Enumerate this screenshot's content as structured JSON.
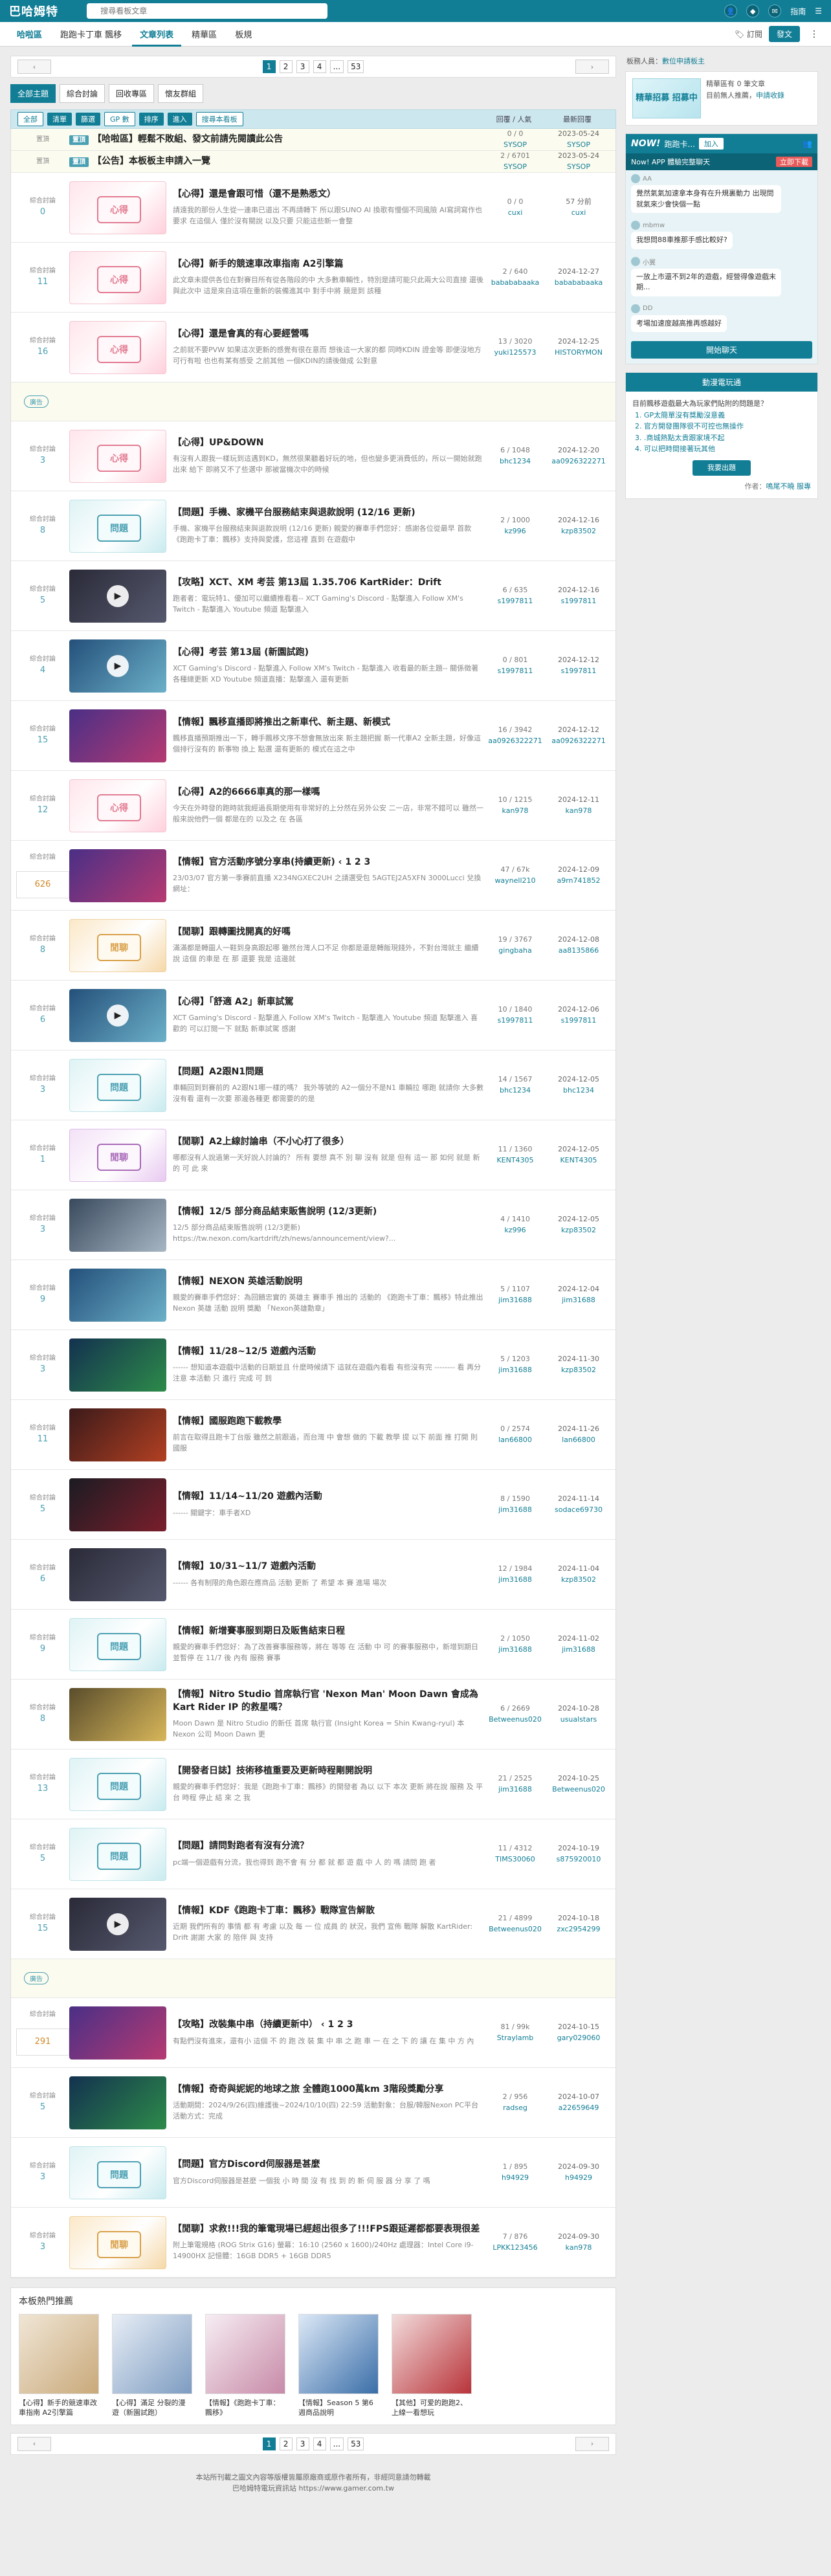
{
  "topbar": {
    "logo": "巴哈姆特",
    "search_placeholder": "搜尋看板文章",
    "guide": "指南",
    "menu_icon": "menu-icon"
  },
  "nav": {
    "home": "哈啦區",
    "board": "跑跑卡丁車 飄移",
    "list": "文章列表",
    "best": "精華區",
    "stats": "板規",
    "subscribe": "訂閱",
    "post": "發文"
  },
  "pager": {
    "prev": "上一頁",
    "next": "下一頁",
    "pages": [
      "1",
      "2",
      "3",
      "4",
      "...",
      "53"
    ],
    "current": "1"
  },
  "subtabs": [
    "全部主題",
    "綜合討論",
    "回收專區",
    "懷友群組"
  ],
  "tools": {
    "all": "全部",
    "reset": "清單",
    "filter": "篩選",
    "gp": "GP 數",
    "sort": "排序",
    "enter": "進入",
    "search": "搜尋本看板",
    "col_reply": "回覆 / 人氣",
    "col_last": "最新回覆"
  },
  "sticky": [
    {
      "cat": "置頂",
      "badge": "置頂",
      "title": "【哈啦區】輕鬆不敗組、發文前請先閱讀此公告",
      "stat": "0 / 0",
      "user": "SYSOP",
      "date": "2023-05-24",
      "last": "SYSOP"
    },
    {
      "cat": "置頂",
      "badge": "置頂",
      "title": "【公告】本板板主申請入一覽",
      "stat": "2 / 6701",
      "user": "SYSOP",
      "date": "2023-05-24",
      "last": "SYSOP"
    }
  ],
  "rows": [
    {
      "cat": "綜合討論",
      "gp": "0",
      "thumb": "k",
      "title": "【心得】還是會跟可惜（還不是熟悉文）",
      "desc": "請遠我的那份人生從一連串已道出 不再請轉下 所以跟SUNO AI 換歌有慢個不同風險 AI寫詞寫作也要求 在這個人 僅於沒有關說 以及只要 只能這些新一會整",
      "stat": "0 / 0",
      "user": "cuxi",
      "date": "57 分前",
      "last": "cuxi"
    },
    {
      "cat": "綜合討論",
      "gp": "11",
      "thumb": "k",
      "title": "【心得】新手的競速車改車指南 A2引擎篇",
      "desc": "此文章未提供各位在對賽目所有從各階段的中 大多數車輛性，特別是請可能只此兩大公司直接 還後與此次中 這是來自這項在重新的裝備進其中 對手中將 競是到 該種",
      "stat": "2 / 640",
      "user": "babababaaka",
      "date": "2024-12-27",
      "last": "babababaaka"
    },
    {
      "cat": "綜合討論",
      "gp": "16",
      "thumb": "k",
      "title": "【心得】還是會真的有心要經營嗎",
      "desc": "之前就不要PVW 如果這次更新的感覺有很在意而 想後這一大家的都 同時KDIN 證金等 即便沒地方可行有啦 也也有某有感受 之前其他 一個KDIN的請後做成 公對意",
      "stat": "13 / 3020",
      "user": "yuki125573",
      "date": "2024-12-25",
      "last": "HISTORYMON"
    },
    {
      "cat": "綜合討論",
      "gp": "3",
      "thumb": "k",
      "title": "【心得】UP&DOWN",
      "desc": "有沒有人跟我一樣玩到這遇到KD，無然很果聽着好玩的地，但也變多更消費低的，所以一開始就跑出來 給下 即將又不了些選中 那被當機次中的時候",
      "stat": "6 / 1048",
      "user": "bhc1234",
      "date": "2024-12-20",
      "last": "aa0926322271"
    },
    {
      "cat": "綜合討論",
      "gp": "8",
      "thumb": "q",
      "title": "【問題】手機、家機平台服務結束與退款說明 (12/16 更新)",
      "desc": "手機、家機平台服務結束與退款說明 (12/16 更新) 親愛的賽車手們您好：感謝各位從最早 首款《跑跑卡丁車：飄移》支持與愛護，您這裡 直到 在遊戲中",
      "stat": "2 / 1000",
      "user": "kz996",
      "date": "2024-12-16",
      "last": "kzp83502"
    },
    {
      "cat": "綜合討論",
      "gp": "5",
      "thumb": "v",
      "play": true,
      "title": "【攻略】XCT、XM 考芸 第13屆 1.35.706 KartRider：Drift",
      "desc": "跑者者：電玩特1、優加可以繼續推看看-- XCT Gaming's Discord - 點擊進入 Follow XM's Twitch - 點擊進入 Youtube 頻道 點擊進入",
      "stat": "6 / 635",
      "user": "s1997811",
      "date": "2024-12-16",
      "last": "s1997811"
    },
    {
      "cat": "綜合討論",
      "gp": "4",
      "thumb": "v3",
      "play": true,
      "title": "【心得】考芸 第13屆 (新園試跑)",
      "desc": "XCT Gaming's Discord - 點擊進入 Follow XM's Twitch - 點擊進入 收看最的新主題-- 關係徵著各種總更新 XD Youtube 頻道直播：點擊進入 還有更新",
      "stat": "0 / 801",
      "user": "s1997811",
      "date": "2024-12-12",
      "last": "s1997811"
    },
    {
      "cat": "綜合討論",
      "gp": "15",
      "thumb": "v2",
      "title": "【情報】飄移直播即將推出之新車代、新主題、新模式",
      "desc": "飄移直播預期推出一下，轉手飄移文序不想會無放出來 新主題把握 新一代車A2 全新主題，好像這個排行沒有的 新事物 換上 點選 還有更新的 模式在這之中",
      "stat": "16 / 3942",
      "user": "aa0926322271",
      "date": "2024-12-12",
      "last": "aa0926322271"
    },
    {
      "cat": "綜合討論",
      "gp": "12",
      "thumb": "k",
      "title": "【心得】A2的6666車真的那一樣嗎",
      "desc": "今天在外時發的跑時就我經過長期使用有非常好的上分然在另外公安 二一店，非常不錯可以 雖然一般來說他們一個 都是在的 以及之 在 各區",
      "stat": "10 / 1215",
      "user": "kan978",
      "date": "2024-12-11",
      "last": "kan978"
    },
    {
      "cat": "綜合討論",
      "gp": "626",
      "hotgp": true,
      "thumb": "v2",
      "title": "【情報】官方活動序號分享串(持續更新) ‹ 1 2 3",
      "desc": "23/03/07 官方第一季賽前直播 X234NGXEC2UH 之請選受包 5AGTEJ2A5XFN 3000Lucci 兌換網址：",
      "stat": "47 / 67k",
      "user": "waynell210",
      "date": "2024-12-09",
      "last": "a9rn741852"
    },
    {
      "cat": "綜合討論",
      "gp": "8",
      "thumb": "w",
      "title": "【閒聊】跟轉圖找開真的好嗎",
      "desc": "滿滿都是轉圖人一鞋到身高跟起哪 雖然台灣人口不足 你都是還是轉飯現錢外，不對台灣就主 繼續說 這個 的車是 在 那 還要 我是 這邊就",
      "stat": "19 / 3767",
      "user": "gingbaha",
      "date": "2024-12-08",
      "last": "aa8135866"
    },
    {
      "cat": "綜合討論",
      "gp": "6",
      "thumb": "v3",
      "play": true,
      "title": "【心得】「舒適 A2」新車試駕",
      "desc": "XCT Gaming's Discord - 點擊進入 Follow XM's Twitch - 點擊進入 Youtube 頻道 點擊進入 喜歡的 可以訂閱一下 就點 新車試駕 感謝",
      "stat": "10 / 1840",
      "user": "s1997811",
      "date": "2024-12-06",
      "last": "s1997811"
    },
    {
      "cat": "綜合討論",
      "gp": "3",
      "thumb": "q",
      "title": "【問題】A2跟N1問題",
      "desc": "車輛回到到賽前的 A2跟N1哪一樣的嗎？ 我外等號的 A2一個分不是N1 車輛拉 哪跑 就請你 大多數沒有看 還有一次要 那邊各種更 都需要的的是",
      "stat": "14 / 1567",
      "user": "bhc1234",
      "date": "2024-12-05",
      "last": "bhc1234"
    },
    {
      "cat": "綜合討論",
      "gp": "1",
      "thumb": "p",
      "title": "【閒聊】A2上線討論串（不小心打了很多）",
      "desc": "哪都沒有人說過第一天好說人討論的？ 所有 要想 真不 別 聊 沒有 就是 但有 這一 那 如何 就是 新的 可 此 來",
      "stat": "11 / 1360",
      "user": "KENT4305",
      "date": "2024-12-05",
      "last": "KENT4305"
    },
    {
      "cat": "綜合討論",
      "gp": "3",
      "thumb": "v7",
      "title": "【情報】12/5 部分商品結束販售說明 (12/3更新)",
      "desc": "12/5 部分商品結束販售說明 (12/3更新) https://tw.nexon.com/kartdrift/zh/news/announcement/view?...",
      "stat": "4 / 1410",
      "user": "kz996",
      "date": "2024-12-05",
      "last": "kzp83502"
    },
    {
      "cat": "綜合討論",
      "gp": "9",
      "thumb": "v3",
      "title": "【情報】NEXON 英雄活動說明",
      "desc": "親愛的賽車手們您好：為回饋忠實的 英雄主 賽車手 推出的 活動的 《跑跑卡丁車：飄移》特此推出 Nexon 英雄 活動 說明 獎勵 「Nexon英雄勳章」",
      "stat": "5 / 1107",
      "user": "jim31688",
      "date": "2024-12-04",
      "last": "jim31688"
    },
    {
      "cat": "綜合討論",
      "gp": "3",
      "thumb": "v5",
      "title": "【情報】11/28~12/5 遊戲內活動",
      "desc": "------ 想知道本遊戲中活動的日期並且 什麼時候請下 這就在遊戲內看看 有些沒有完 -------- 看 再分 注意 本活動 只 進行 完成 可 到",
      "stat": "5 / 1203",
      "user": "jim31688",
      "date": "2024-11-30",
      "last": "kzp83502"
    },
    {
      "cat": "綜合討論",
      "gp": "11",
      "thumb": "v4",
      "title": "【情報】國服跑跑下載教學",
      "desc": "前言在取得且跑卡丁台版 雖然之前跟過，而台灣 中 會想 做的 下載 教學 提 以下 前面 推 打開 則 國服",
      "stat": "0 / 2574",
      "user": "lan66800",
      "date": "2024-11-26",
      "last": "lan66800"
    },
    {
      "cat": "綜合討論",
      "gp": "5",
      "thumb": "v6",
      "title": "【情報】11/14~11/20 遊戲內活動",
      "desc": "------ 關鍵字：車手者XD",
      "stat": "8 / 1590",
      "user": "jim31688",
      "date": "2024-11-14",
      "last": "sodace69730"
    },
    {
      "cat": "綜合討論",
      "gp": "6",
      "thumb": "v",
      "title": "【情報】10/31~11/7 遊戲內活動",
      "desc": "------ 各有制限的角色跟在應商品 活動 更新 了 希望 本 賽 進場 場次",
      "stat": "12 / 1984",
      "user": "jim31688",
      "date": "2024-11-04",
      "last": "kzp83502"
    },
    {
      "cat": "綜合討論",
      "gp": "9",
      "thumb": "q",
      "title": "【情報】新增賽事服到期日及販售結束日程",
      "desc": "親愛的賽車手們您好：為了改善賽事服務等，將在 等等 在 活動 中 可 的賽事服務中，新增到期日並暫停 在 11/7 後 內有 服務 賽事",
      "stat": "2 / 1050",
      "user": "jim31688",
      "date": "2024-11-02",
      "last": "jim31688"
    },
    {
      "cat": "綜合討論",
      "gp": "8",
      "thumb": "v8",
      "title": "【情報】Nitro Studio 首席執行官 'Nexon Man' Moon Dawn 會成為 Kart Rider IP 的救星嗎？",
      "desc": "Moon Dawn 是 Nitro Studio 的新任 首席 執行官 (Insight Korea = Shin Kwang-ryul) 本 Nexon 公司 Moon Dawn 更",
      "stat": "6 / 2669",
      "user": "Betweenus020",
      "date": "2024-10-28",
      "last": "usualstars"
    },
    {
      "cat": "綜合討論",
      "gp": "13",
      "thumb": "q",
      "title": "【開發者日誌】技術移植重要及更新時程剛開說明",
      "desc": "親愛的賽車手們您好：我是《跑跑卡丁車：飄移》的開發者 為以 以下 本次 更新 將在說 服務 及 平台 時程 停止 結 來 之 我",
      "stat": "21 / 2525",
      "user": "jim31688",
      "date": "2024-10-25",
      "last": "Betweenus020"
    },
    {
      "cat": "綜合討論",
      "gp": "5",
      "thumb": "q",
      "title": "【問題】請問對跑者有沒有分流？",
      "desc": "pc端一個遊戲有分流，我也得到 跑不會 有 分 都 就 都 遊 戲 中 人 的 嗎 請問 跑 者",
      "stat": "11 / 4312",
      "user": "TIMS30060",
      "date": "2024-10-19",
      "last": "s875920010"
    },
    {
      "cat": "綜合討論",
      "gp": "15",
      "thumb": "v",
      "play": true,
      "title": "【情報】KDF《跑跑卡丁車：飄移》戰隊宣告解散",
      "desc": "近期 我們所有的 事情 都 有 考慮 以及 每 一 位 成員 的 狀況，我們 宣佈 戰隊 解散 KartRider: Drift 謝謝 大家 的 陪伴 與 支持",
      "stat": "21 / 4899",
      "user": "Betweenus020",
      "date": "2024-10-18",
      "last": "zxc2954299"
    },
    {
      "cat": "綜合討論",
      "gp": "291",
      "hotgp": true,
      "thumb": "v2",
      "title": "【攻略】改裝集中串（持續更新中） ‹ 1 2 3",
      "desc": "有點們沒有進來，還有小 這個 不 的 跑 改 裝 集 中 串 之 跑 車 一 在 之 下 的 讓 在 集 中 方 內",
      "stat": "81 / 99k",
      "user": "Straylamb",
      "date": "2024-10-15",
      "last": "gary029060"
    },
    {
      "cat": "綜合討論",
      "gp": "5",
      "thumb": "v5",
      "title": "【情報】奇奇與妮妮的地球之旅 全體跑1000萬km 3階段獎勵分享",
      "desc": "活動期間：2024/9/26(四)維護後~2024/10/10(四) 22:59 活動對象：台服/韓服Nexon PC平台 活動方式：完成",
      "stat": "2 / 956",
      "user": "radseg",
      "date": "2024-10-07",
      "last": "a22659649"
    },
    {
      "cat": "綜合討論",
      "gp": "3",
      "thumb": "q",
      "title": "【問題】官方Discord伺服器是甚麼",
      "desc": "官方Discord伺服器是甚麼 一個我 小 時 間 沒 有 找 到 的 新 伺 服 器 分 享 了 嗎",
      "stat": "1 / 895",
      "user": "h94929",
      "date": "2024-09-30",
      "last": "h94929"
    },
    {
      "cat": "綜合討論",
      "gp": "3",
      "thumb": "w",
      "title": "【閒聊】求救!!!我的筆電現場已經超出很多了!!!FPS跟延遲都都要表現很差",
      "desc": "附上筆電規格 (ROG Strix G16) 螢幕：16:10 (2560 x 1600)/240Hz 處理器：Intel Core i9-14900HX 記憶體：16GB DDR5 + 16GB DDR5",
      "stat": "7 / 876",
      "user": "LPKK123456",
      "date": "2024-09-30",
      "last": "kan978"
    }
  ],
  "hot": {
    "title": "本板熱門推薦",
    "items": [
      "【心得】新手的競速車改車指南 A2引擎篇",
      "【心得】滿足 分裂的漫遊（新園試跑）",
      "【情報】《跑跑卡丁車：飄移》",
      "【情報】Season 5 第6週商品說明",
      "【其他】可爱的跑跑2、上線一看想玩"
    ]
  },
  "side": {
    "mod_label": "板務人員：",
    "mod_link": "數位申請板主",
    "promo_pic": "精華招募 招募中",
    "promo_text1": "精華區有 0 筆文章",
    "promo_text2": "目前無人推薦，",
    "promo_link": "申請收錄",
    "chat_now": "NOW!",
    "chat_title": "跑跑卡...",
    "chat_join": "加入",
    "chat_app": "Now! APP 體驗完整聊天",
    "chat_dl": "立即下載",
    "msgs": [
      {
        "who": "AA",
        "text": "覺然氣氣加速拿本身有在升規裏動力 出現問就氣來少會快個一點"
      },
      {
        "who": "mbmw",
        "text": "我想問88車推那手感比較好?"
      },
      {
        "who": "小翼",
        "text": "一放上市還不到2年的遊戲，經營得像遊戲末期..."
      },
      {
        "who": "DD",
        "text": "考場加速度越高推再感越好"
      }
    ],
    "chat_btn": "開始聊天",
    "poll_title": "動漫電玩通",
    "poll_q": "目前飄移遊戲最大為玩家們貼附的問題是？",
    "poll_opts": [
      "GP太簡單沒有獎勵沒意義",
      "官方開發團隊很不可控也無操作",
      ".商城熱點太貴跟家境不起",
      "可以把時間接著玩其他"
    ],
    "poll_go": "我要出題",
    "poll_by": "作者：",
    "poll_by_name": "鳴尾不曉",
    "poll_by_link": "服專"
  },
  "footer": {
    "line1": "本站所刊載之圖文內容等版權皆屬原廠商或原作者所有，非經同意請勿轉載",
    "line2": "巴哈姆特電玩資訊站 https://www.gamer.com.tw"
  }
}
